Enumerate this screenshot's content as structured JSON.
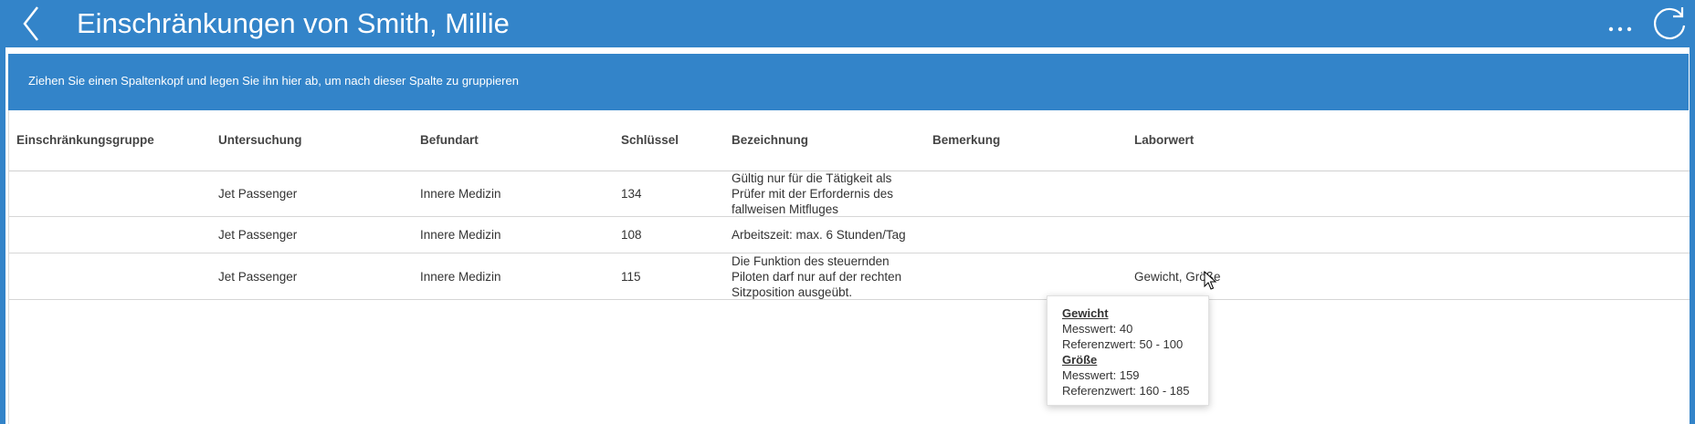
{
  "window": {
    "title": "Einschränkungen von Smith, Millie",
    "accent_color": "#3384c9",
    "back_icon": "chevron-left-icon",
    "more_icon": "more-icon",
    "refresh_icon": "refresh-icon"
  },
  "group_panel": {
    "text": "Ziehen Sie einen Spaltenkopf und legen Sie ihn hier ab, um nach dieser Spalte zu gruppieren"
  },
  "grid": {
    "columns": [
      "Einschränkungsgruppe",
      "Untersuchung",
      "Befundart",
      "Schlüssel",
      "Bezeichnung",
      "Bemerkung",
      "Laborwert"
    ],
    "rows": [
      [
        "",
        "Jet Passenger",
        "Innere Medizin",
        "134",
        "Gültig nur für die Tätigkeit als Prüfer mit der Erfordernis des fallweisen Mitfluges",
        "",
        ""
      ],
      [
        "",
        "Jet Passenger",
        "Innere Medizin",
        "108",
        "Arbeitszeit: max. 6 Stunden/Tag",
        "",
        ""
      ],
      [
        "",
        "Jet Passenger",
        "Innere Medizin",
        "115",
        "Die Funktion des steuernden Piloten darf nur auf der rechten Sitzposition ausgeübt.",
        "",
        "Gewicht, Größe"
      ]
    ]
  },
  "tooltip": {
    "sections": [
      {
        "title": "Gewicht",
        "messwert": "Messwert: 40",
        "referenz": "Referenzwert: 50 - 100"
      },
      {
        "title": "Größe",
        "messwert": "Messwert: 159",
        "referenz": "Referenzwert: 160 - 185"
      }
    ]
  }
}
